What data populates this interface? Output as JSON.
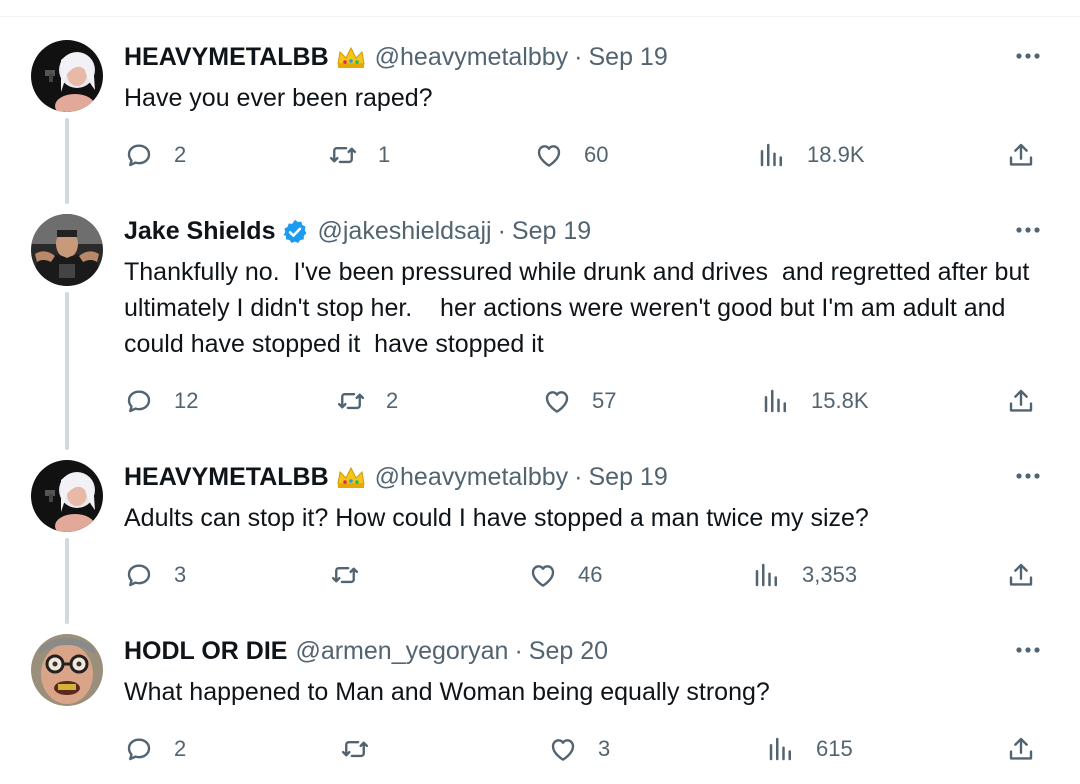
{
  "tweets": [
    {
      "name": "HEAVYMETALBB",
      "badge": "crown-emoji",
      "handle": "@heavymetalbby",
      "date": "Sep 19",
      "text": "Have you ever been raped?",
      "replies": "2",
      "retweets": "1",
      "likes": "60",
      "views": "18.9K"
    },
    {
      "name": "Jake Shields",
      "badge": "verified-badge",
      "handle": "@jakeshieldsajj",
      "date": "Sep 19",
      "text": "Thankfully no.  I've been pressured while drunk and drives  and regretted after but ultimately I didn't stop her.    her actions were weren't good but I'm am adult and could have stopped it  have stopped it",
      "replies": "12",
      "retweets": "2",
      "likes": "57",
      "views": "15.8K"
    },
    {
      "name": "HEAVYMETALBB",
      "badge": "crown-emoji",
      "handle": "@heavymetalbby",
      "date": "Sep 19",
      "text": "Adults can stop it? How could I have stopped a man twice my size?",
      "replies": "3",
      "retweets": "",
      "likes": "46",
      "views": "3,353"
    },
    {
      "name": "HODL OR DIE",
      "badge": "",
      "handle": "@armen_yegoryan",
      "date": "Sep 20",
      "text": "What happened to Man and Woman being equally strong?",
      "replies": "2",
      "retweets": "",
      "likes": "3",
      "views": "615"
    }
  ],
  "separator": "·",
  "colors": {
    "text": "#0f1419",
    "secondary": "#536471",
    "verified": "#1d9bf0",
    "thread_line": "#cfd9de",
    "crown": "#f5c518"
  },
  "icons": {
    "reply": "reply-icon",
    "retweet": "retweet-icon",
    "like": "heart-icon",
    "views": "views-icon",
    "share": "share-icon",
    "more": "more-icon"
  }
}
